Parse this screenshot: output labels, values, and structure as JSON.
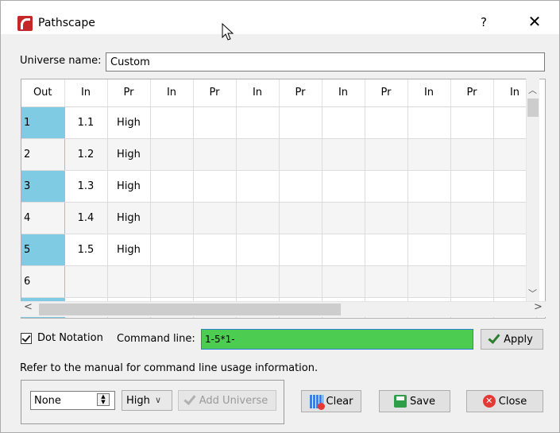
{
  "window": {
    "title": "Pathscape",
    "help_glyph": "?",
    "close_glyph": "✕"
  },
  "universe": {
    "label": "Universe name:",
    "value": "Custom"
  },
  "grid": {
    "headers": [
      "Out",
      "In",
      "Pr",
      "In",
      "Pr",
      "In",
      "Pr",
      "In",
      "Pr",
      "In",
      "Pr",
      "In"
    ],
    "rows": [
      [
        "1",
        "1.1",
        "High",
        "",
        "",
        "",
        "",
        "",
        "",
        "",
        "",
        ""
      ],
      [
        "2",
        "1.2",
        "High",
        "",
        "",
        "",
        "",
        "",
        "",
        "",
        "",
        ""
      ],
      [
        "3",
        "1.3",
        "High",
        "",
        "",
        "",
        "",
        "",
        "",
        "",
        "",
        ""
      ],
      [
        "4",
        "1.4",
        "High",
        "",
        "",
        "",
        "",
        "",
        "",
        "",
        "",
        ""
      ],
      [
        "5",
        "1.5",
        "High",
        "",
        "",
        "",
        "",
        "",
        "",
        "",
        "",
        ""
      ],
      [
        "6",
        "",
        "",
        "",
        "",
        "",
        "",
        "",
        "",
        "",
        "",
        ""
      ],
      [
        "",
        "",
        "",
        "",
        "",
        "",
        "",
        "",
        "",
        "",
        "",
        ""
      ]
    ],
    "out_column_color": "#7ecbe3"
  },
  "options": {
    "dot_notation_label": "Dot Notation",
    "dot_notation_checked": true,
    "command_label": "Command line:",
    "command_value": "1-5*1-",
    "command_bg_color": "#4ccd52",
    "apply_label": "Apply"
  },
  "help_text": "Refer to the manual for command line usage information.",
  "bottom": {
    "spin_value": "None",
    "priority_value": "High",
    "add_universe_label": "Add Universe",
    "clear_label": "Clear",
    "save_label": "Save",
    "close_label": "Close"
  },
  "icons": {
    "app": "pathscape-logo-icon",
    "apply": "checkmark-icon",
    "clear": "clear-grid-icon",
    "save": "save-icon",
    "close": "close-circle-icon"
  }
}
